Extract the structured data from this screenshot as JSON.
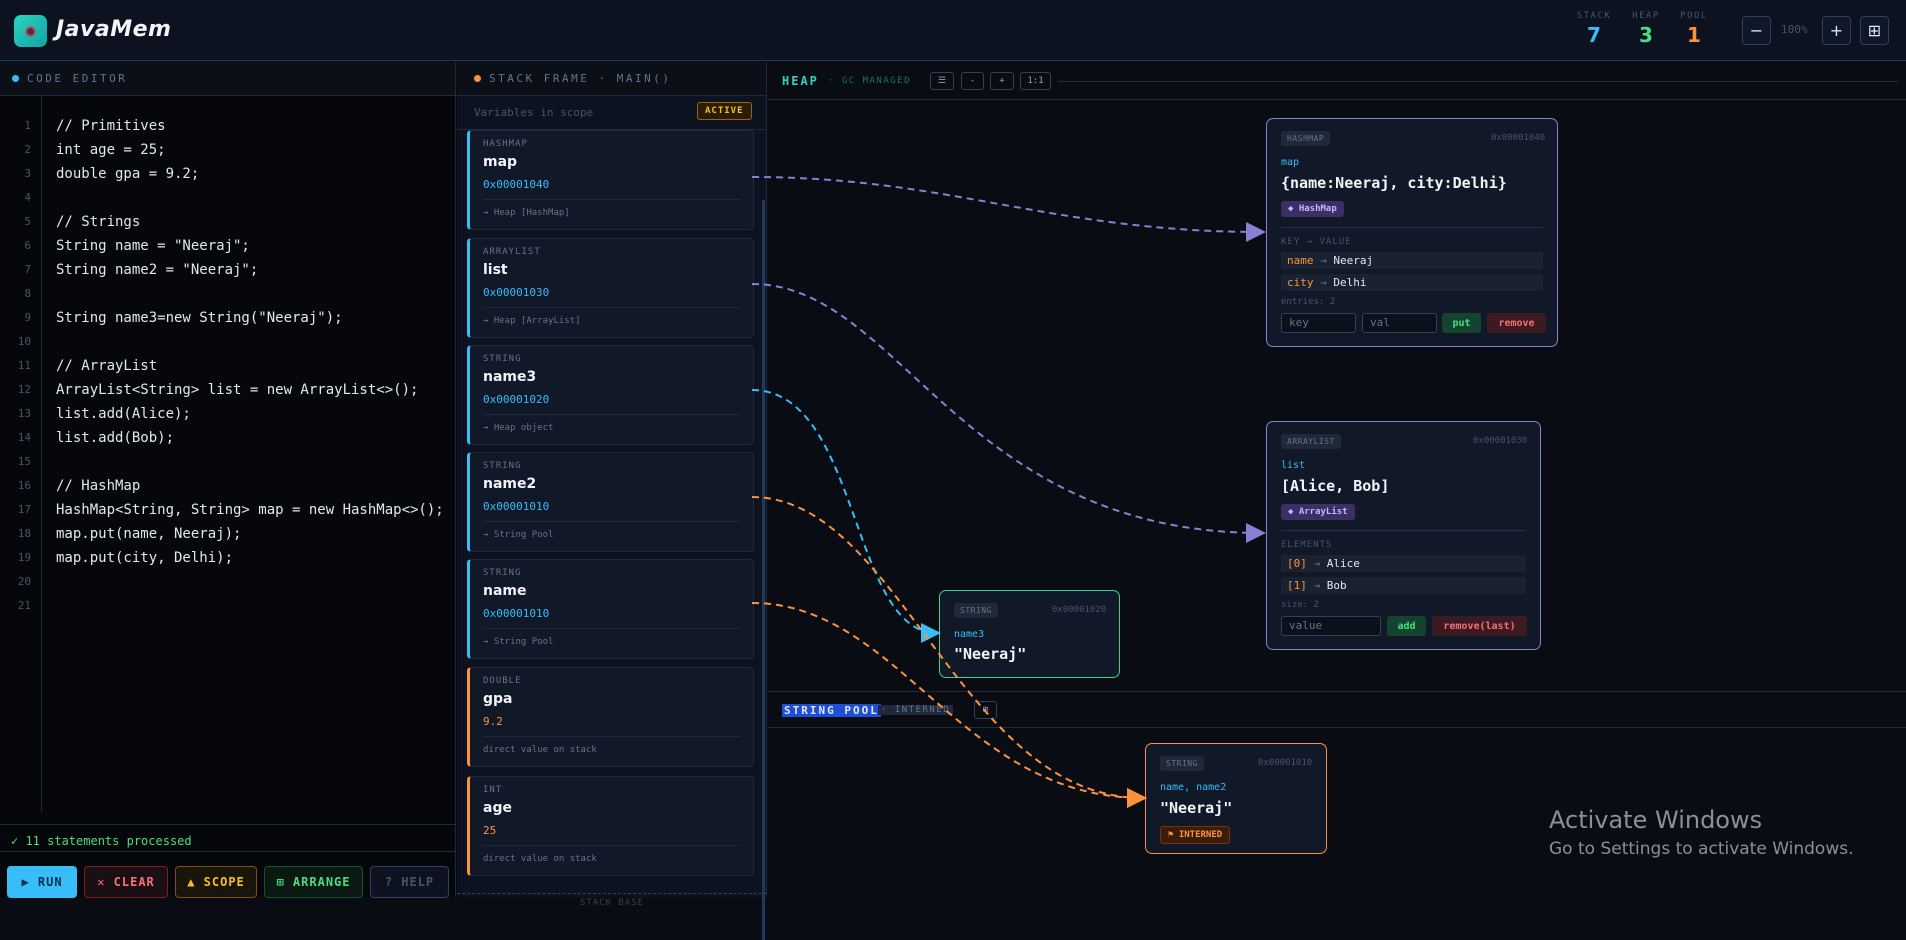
{
  "app": {
    "title": "JavaMem"
  },
  "stats": [
    {
      "label": "STACK",
      "value": "7",
      "color": "#38bdf8"
    },
    {
      "label": "HEAP",
      "value": "3",
      "color": "#4ade80"
    },
    {
      "label": "POOL",
      "value": "1",
      "color": "#fb923c"
    }
  ],
  "zoom": {
    "minus": "−",
    "level": "100%",
    "plus": "+",
    "fit": "⊞"
  },
  "editor": {
    "title": "CODE EDITOR",
    "line_numbers": [
      "1",
      "2",
      "3",
      "4",
      "5",
      "6",
      "7",
      "8",
      "9",
      "10",
      "11",
      "12",
      "13",
      "14",
      "15",
      "16",
      "17",
      "18",
      "19",
      "20",
      "21"
    ],
    "lines": [
      "// Primitives",
      "int age = 25;",
      "double gpa = 9.2;",
      "",
      "// Strings",
      "String name = \"Neeraj\";",
      "String name2 = \"Neeraj\";",
      "",
      "String name3=new String(\"Neeraj\");",
      "",
      "// ArrayList",
      "ArrayList<String> list = new ArrayList<>();",
      "list.add(Alice);",
      "list.add(Bob);",
      "",
      "// HashMap",
      "HashMap<String, String> map = new HashMap<>();",
      "map.put(name, Neeraj);",
      "map.put(city, Delhi);",
      "",
      ""
    ],
    "status": "✓ 11 statements processed"
  },
  "actions": {
    "run": "▶ RUN",
    "clear": "✕ CLEAR",
    "scope": "▲ SCOPE",
    "arrange": "⊞ ARRANGE",
    "help": "? HELP"
  },
  "stack": {
    "title": "STACK FRAME · MAIN()",
    "subtitle": "Variables in scope",
    "active": "ACTIVE",
    "base": "STACK BASE",
    "frames": [
      {
        "type": "HASHMAP",
        "name": "map",
        "addr": "0x00001040",
        "ref": "→ Heap [HashMap]"
      },
      {
        "type": "ARRAYLIST",
        "name": "list",
        "addr": "0x00001030",
        "ref": "→ Heap [ArrayList]"
      },
      {
        "type": "STRING",
        "name": "name3",
        "addr": "0x00001020",
        "ref": "→ Heap object"
      },
      {
        "type": "STRING",
        "name": "name2",
        "addr": "0x00001010",
        "ref": "→ String Pool"
      },
      {
        "type": "STRING",
        "name": "name",
        "addr": "0x00001010",
        "ref": "→ String Pool"
      },
      {
        "type": "DOUBLE",
        "name": "gpa",
        "addr": "9.2",
        "ref": "direct value on stack"
      },
      {
        "type": "INT",
        "name": "age",
        "addr": "25",
        "ref": "direct value on stack"
      }
    ]
  },
  "heap": {
    "title": "HEAP",
    "subtitle": "· GC MANAGED",
    "toolbar": [
      "☰",
      "-",
      "+",
      "1:1"
    ],
    "hashmap": {
      "badge": "HASHMAP",
      "addr": "0x00001040",
      "var": "map",
      "value": "{name:Neeraj, city:Delhi}",
      "tag": "◆ HashMap",
      "section": "KEY → VALUE",
      "entries": [
        {
          "k": "name",
          "v": "Neeraj"
        },
        {
          "k": "city",
          "v": "Delhi"
        }
      ],
      "count": "entries: 2",
      "key_ph": "key",
      "val_ph": "val",
      "put": "put",
      "remove": "remove"
    },
    "arraylist": {
      "badge": "ARRAYLIST",
      "addr": "0x00001030",
      "var": "list",
      "value": "[Alice, Bob]",
      "tag": "◆ ArrayList",
      "section": "ELEMENTS",
      "entries": [
        {
          "k": "[0]",
          "v": "Alice"
        },
        {
          "k": "[1]",
          "v": "Bob"
        }
      ],
      "count": "size: 2",
      "val_ph": "value",
      "add": "add",
      "remove": "remove(last)"
    },
    "string_obj": {
      "badge": "STRING",
      "addr": "0x00001020",
      "var": "name3",
      "value": "\"Neeraj\""
    }
  },
  "pool": {
    "title": "STRING POOL",
    "subtitle": "· INTERNED",
    "btn": "⊞",
    "obj": {
      "badge": "STRING",
      "addr": "0x00001010",
      "var": "name, name2",
      "value": "\"Neeraj\"",
      "tag": "⚑ INTERNED"
    }
  },
  "watermark": {
    "line1": "Activate Windows",
    "line2": "Go to Settings to activate Windows."
  }
}
